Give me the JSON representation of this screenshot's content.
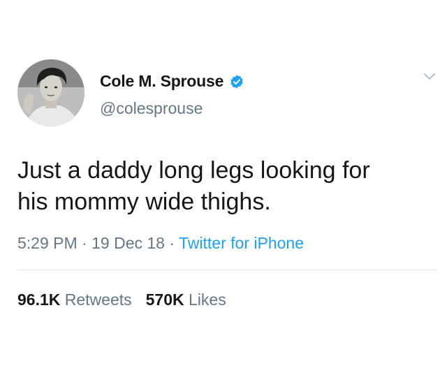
{
  "author": {
    "display_name": "Cole M. Sprouse",
    "handle": "@colesprouse",
    "verified": true,
    "verified_color": "#1da1f2"
  },
  "tweet": {
    "text_lines": [
      "Just a daddy long legs looking for",
      "his mommy wide thighs."
    ],
    "time": "5:29 PM",
    "date": "19 Dec 18",
    "separator": "·",
    "source": "Twitter for iPhone"
  },
  "stats": {
    "retweets_count": "96.1K",
    "retweets_label": "Retweets",
    "likes_count": "570K",
    "likes_label": "Likes"
  },
  "icons": {
    "verified": "verified-badge-icon",
    "menu": "chevron-down-icon"
  },
  "colors": {
    "text": "#14171a",
    "secondary": "#657786",
    "link": "#1da1f2",
    "divider": "#e1e8ed"
  }
}
